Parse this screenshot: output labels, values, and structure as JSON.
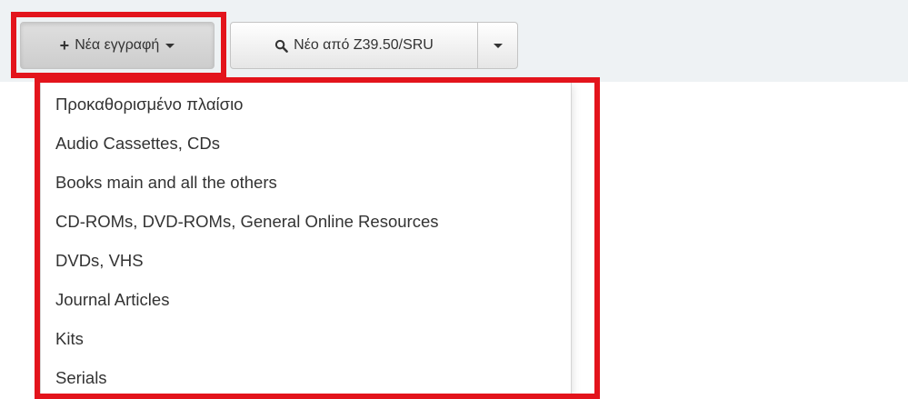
{
  "toolbar": {
    "new_record_label": "Νέα εγγραφή",
    "new_from_z3950_label": "Νέο από Z39.50/SRU"
  },
  "dropdown": {
    "items": [
      {
        "label": "Προκαθορισμένο πλαίσιο"
      },
      {
        "label": "Audio Cassettes, CDs"
      },
      {
        "label": "Books main and all the others"
      },
      {
        "label": "CD-ROMs, DVD-ROMs, General Online Resources"
      },
      {
        "label": "DVDs, VHS"
      },
      {
        "label": "Journal Articles"
      },
      {
        "label": "Kits"
      },
      {
        "label": "Serials"
      }
    ]
  },
  "icons": {
    "plus": "plus-icon",
    "search": "search-icon",
    "caret": "caret-down-icon"
  },
  "colors": {
    "highlight": "#e3141c",
    "toolbar_background": "#eef2f4"
  }
}
